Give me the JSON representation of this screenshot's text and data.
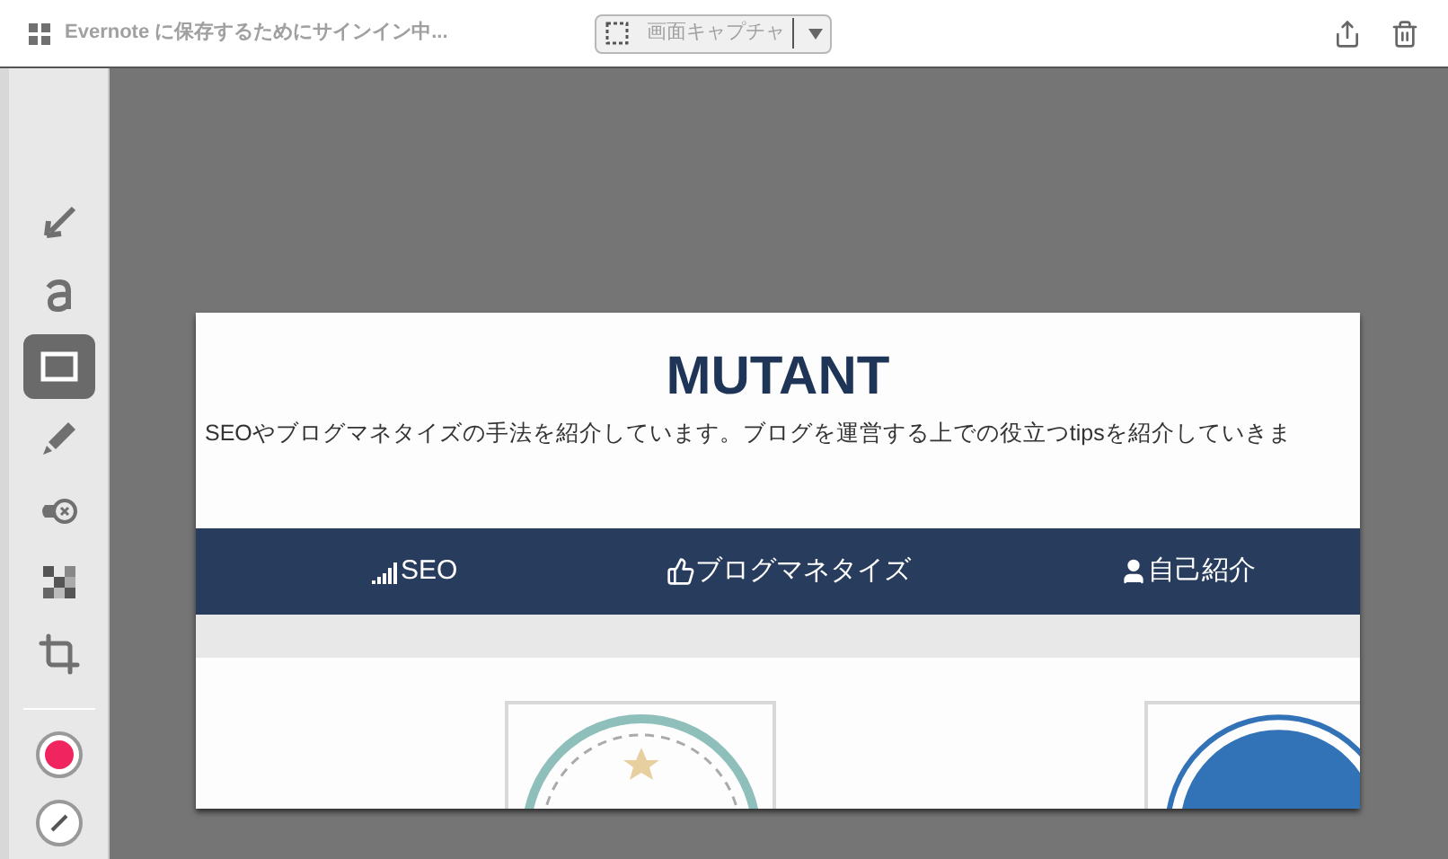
{
  "header": {
    "status": "Evernote に保存するためにサインイン中...",
    "capture_mode": "画面キャプチャ"
  },
  "tools": [
    {
      "selected": false
    },
    {
      "selected": false
    },
    {
      "selected": true
    },
    {
      "selected": false
    },
    {
      "selected": false
    },
    {
      "selected": false
    },
    {
      "selected": false
    }
  ],
  "color_picker": {
    "color": "#f0245e"
  },
  "capture": {
    "title": "MUTANT",
    "tagline": "SEOやブログマネタイズの手法を紹介しています。ブログを運営する上での役立つtipsを紹介していきま",
    "nav": [
      "SEO",
      "ブログマネタイズ",
      "自己紹介"
    ]
  }
}
